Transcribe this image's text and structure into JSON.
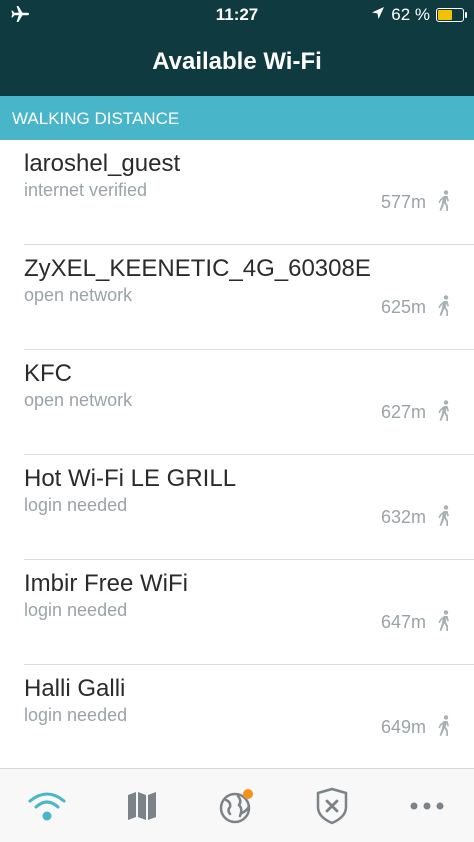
{
  "status_bar": {
    "time": "11:27",
    "battery": "62 %",
    "battery_level": 0.62,
    "icons": [
      "airplane-icon",
      "location-arrow-icon",
      "battery-icon"
    ]
  },
  "header": {
    "title": "Available Wi-Fi"
  },
  "section": {
    "label": "WALKING DISTANCE"
  },
  "networks": [
    {
      "name": "laroshel_guest",
      "status": "internet verified",
      "distance": "577m"
    },
    {
      "name": "ZyXEL_KEENETIC_4G_60308E",
      "status": "open network",
      "distance": "625m"
    },
    {
      "name": "KFC",
      "status": "open network",
      "distance": "627m"
    },
    {
      "name": "Hot Wi-Fi LE GRILL",
      "status": "login needed",
      "distance": "632m"
    },
    {
      "name": "Imbir Free WiFi",
      "status": "login needed",
      "distance": "647m"
    },
    {
      "name": "Halli Galli",
      "status": "login needed",
      "distance": "649m"
    }
  ],
  "tabs": [
    {
      "icon": "wifi-icon",
      "active": true
    },
    {
      "icon": "map-icon",
      "active": false
    },
    {
      "icon": "globe-icon",
      "active": false,
      "badge": true
    },
    {
      "icon": "shield-icon",
      "active": false
    },
    {
      "icon": "more-icon",
      "active": false
    }
  ],
  "colors": {
    "header_bg": "#0e3a40",
    "section_bg": "#48b5c8",
    "accent": "#48b5c8",
    "badge": "#f5921e",
    "battery": "#f2c200"
  }
}
